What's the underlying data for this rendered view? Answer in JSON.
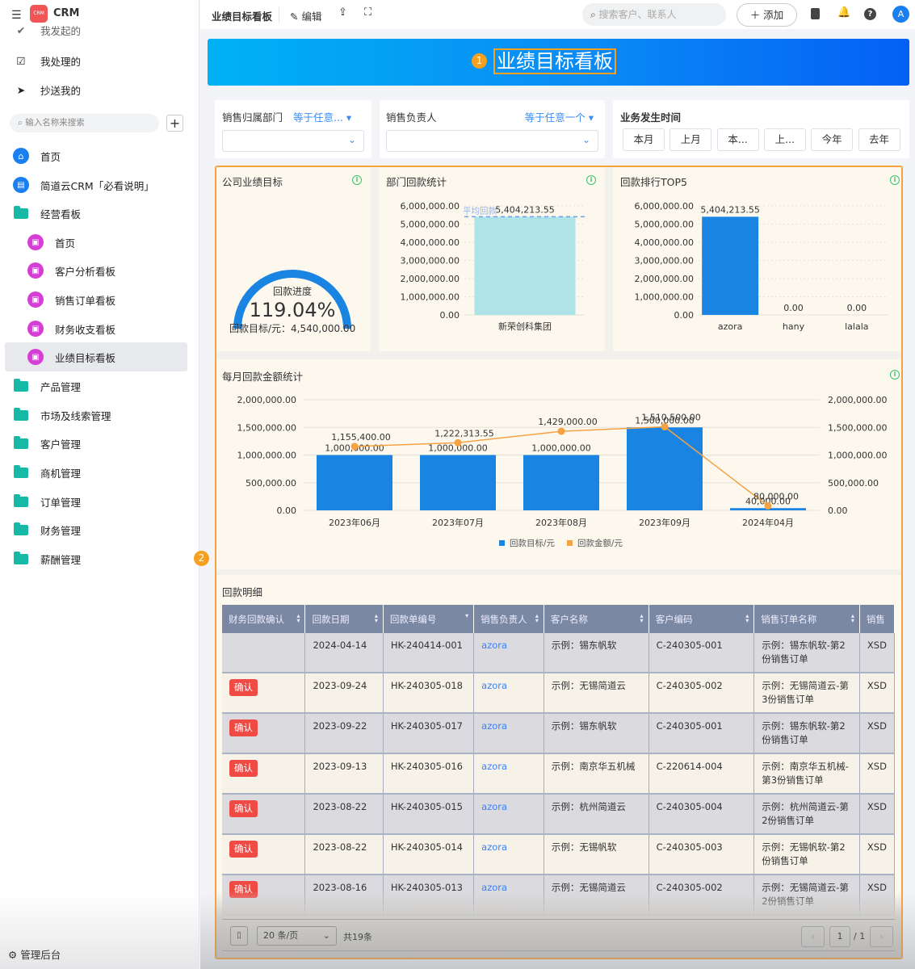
{
  "app": {
    "name": "CRM",
    "logo_text": "CRM"
  },
  "sidebar": {
    "top_items": [
      {
        "label": "我发起的"
      },
      {
        "label": "我处理的"
      },
      {
        "label": "抄送我的"
      }
    ],
    "search_placeholder": "输入名称来搜索",
    "items": [
      {
        "label": "首页",
        "level": 0,
        "icon": "home-icon"
      },
      {
        "label": "简道云CRM「必看说明」",
        "level": 0,
        "icon": "doc-icon"
      },
      {
        "label": "经营看板",
        "level": 0,
        "icon": "folder-icon"
      },
      {
        "label": "首页",
        "level": 1,
        "icon": "dashboard-icon"
      },
      {
        "label": "客户分析看板",
        "level": 1,
        "icon": "dashboard-icon"
      },
      {
        "label": "销售订单看板",
        "level": 1,
        "icon": "dashboard-icon"
      },
      {
        "label": "财务收支看板",
        "level": 1,
        "icon": "dashboard-icon"
      },
      {
        "label": "业绩目标看板",
        "level": 1,
        "icon": "dashboard-icon",
        "active": true
      },
      {
        "label": "产品管理",
        "level": 0,
        "icon": "folder-icon"
      },
      {
        "label": "市场及线索管理",
        "level": 0,
        "icon": "folder-icon"
      },
      {
        "label": "客户管理",
        "level": 0,
        "icon": "folder-icon"
      },
      {
        "label": "商机管理",
        "level": 0,
        "icon": "folder-icon"
      },
      {
        "label": "订单管理",
        "level": 0,
        "icon": "folder-icon"
      },
      {
        "label": "财务管理",
        "level": 0,
        "icon": "folder-icon"
      },
      {
        "label": "薪酬管理",
        "level": 0,
        "icon": "folder-icon"
      }
    ],
    "admin_label": "管理后台"
  },
  "topbar": {
    "title": "业绩目标看板",
    "edit_label": "编辑",
    "search_placeholder": "搜索客户、联系人",
    "add_label": "添加",
    "avatar": "A"
  },
  "banner": {
    "title": "业绩目标看板",
    "marker1": "1",
    "marker2": "2"
  },
  "filters": {
    "dept": {
      "label": "销售归属部门",
      "op": "等于任意..."
    },
    "owner": {
      "label": "销售负责人",
      "op": "等于任意一个"
    },
    "time": {
      "label": "业务发生时间",
      "buttons": [
        "本月",
        "上月",
        "本...",
        "上...",
        "今年",
        "去年"
      ]
    }
  },
  "colors": {
    "accent": "#1a84e3",
    "orange": "#f5a342",
    "teal": "#aee4e8",
    "confirm": "#f04a45"
  },
  "chart_data": [
    {
      "type": "gauge",
      "title": "公司业绩目标",
      "label": "回款进度",
      "value_text": "119.04%",
      "value": 1.1904,
      "target_text": "回款目标/元：4,540,000.00"
    },
    {
      "type": "bar",
      "title": "部门回款统计",
      "categories": [
        "新荣创科集团"
      ],
      "values": [
        5404213.55
      ],
      "value_labels": [
        "5,404,213.55"
      ],
      "avg_label": "平均回款",
      "ylim": [
        0,
        6000000
      ],
      "yticks": [
        "0.00",
        "1,000,000.00",
        "2,000,000.00",
        "3,000,000.00",
        "4,000,000.00",
        "5,000,000.00",
        "6,000,000.00"
      ]
    },
    {
      "type": "bar",
      "title": "回款排行TOP5",
      "categories": [
        "azora",
        "hany",
        "lalala"
      ],
      "values": [
        5404213.55,
        0,
        0
      ],
      "value_labels": [
        "5,404,213.55",
        "0.00",
        "0.00"
      ],
      "ylim": [
        0,
        6000000
      ],
      "yticks": [
        "0.00",
        "1,000,000.00",
        "2,000,000.00",
        "3,000,000.00",
        "4,000,000.00",
        "5,000,000.00",
        "6,000,000.00"
      ]
    },
    {
      "type": "bar+line",
      "title": "每月回款金额统计",
      "categories": [
        "2023年06月",
        "2023年07月",
        "2023年08月",
        "2023年09月",
        "2024年04月"
      ],
      "series": [
        {
          "name": "回款目标/元",
          "type": "bar",
          "values": [
            1000000,
            1000000,
            1000000,
            1500000,
            40000
          ],
          "value_labels": [
            "1,000,000.00",
            "1,000,000.00",
            "1,000,000.00",
            "1,500,000.00",
            "40,000.00"
          ]
        },
        {
          "name": "回款金额/元",
          "type": "line",
          "values": [
            1155400,
            1222313.55,
            1429000,
            1510500,
            80000
          ],
          "value_labels": [
            "1,155,400.00",
            "1,222,313.55",
            "1,429,000.00",
            "1,510,500.00",
            "80,000.00"
          ]
        }
      ],
      "ylim": [
        0,
        2000000
      ],
      "yticks": [
        "0.00",
        "500,000.00",
        "1,000,000.00",
        "1,500,000.00",
        "2,000,000.00"
      ],
      "legend": "bottom"
    }
  ],
  "table": {
    "title": "回款明细",
    "columns": [
      "财务回款确认",
      "回款日期",
      "回款单编号",
      "销售负责人",
      "客户名称",
      "客户编码",
      "销售订单名称",
      "销售"
    ],
    "rows": [
      [
        "",
        "2024-04-14",
        "HK-240414-001",
        "azora",
        "示例：锡东帆软",
        "C-240305-001",
        "示例：锡东帆软-第2份销售订单",
        "XSD"
      ],
      [
        "确认",
        "2023-09-24",
        "HK-240305-018",
        "azora",
        "示例：无锡简道云",
        "C-240305-002",
        "示例：无锡简道云-第3份销售订单",
        "XSD"
      ],
      [
        "确认",
        "2023-09-22",
        "HK-240305-017",
        "azora",
        "示例：锡东帆软",
        "C-240305-001",
        "示例：锡东帆软-第2份销售订单",
        "XSD"
      ],
      [
        "确认",
        "2023-09-13",
        "HK-240305-016",
        "azora",
        "示例：南京华五机械",
        "C-220614-004",
        "示例：南京华五机械-第3份销售订单",
        "XSD"
      ],
      [
        "确认",
        "2023-08-22",
        "HK-240305-015",
        "azora",
        "示例：杭州简道云",
        "C-240305-004",
        "示例：杭州简道云-第2份销售订单",
        "XSD"
      ],
      [
        "确认",
        "2023-08-22",
        "HK-240305-014",
        "azora",
        "示例：无锡帆软",
        "C-240305-003",
        "示例：无锡帆软-第2份销售订单",
        "XSD"
      ],
      [
        "确认",
        "2023-08-16",
        "HK-240305-013",
        "azora",
        "示例：无锡简道云",
        "C-240305-002",
        "示例：无锡简道云-第2份销售订单",
        "XSD"
      ]
    ],
    "page_size": "20 条/页",
    "total": "共19条",
    "page": "1",
    "pages": "/ 1"
  }
}
